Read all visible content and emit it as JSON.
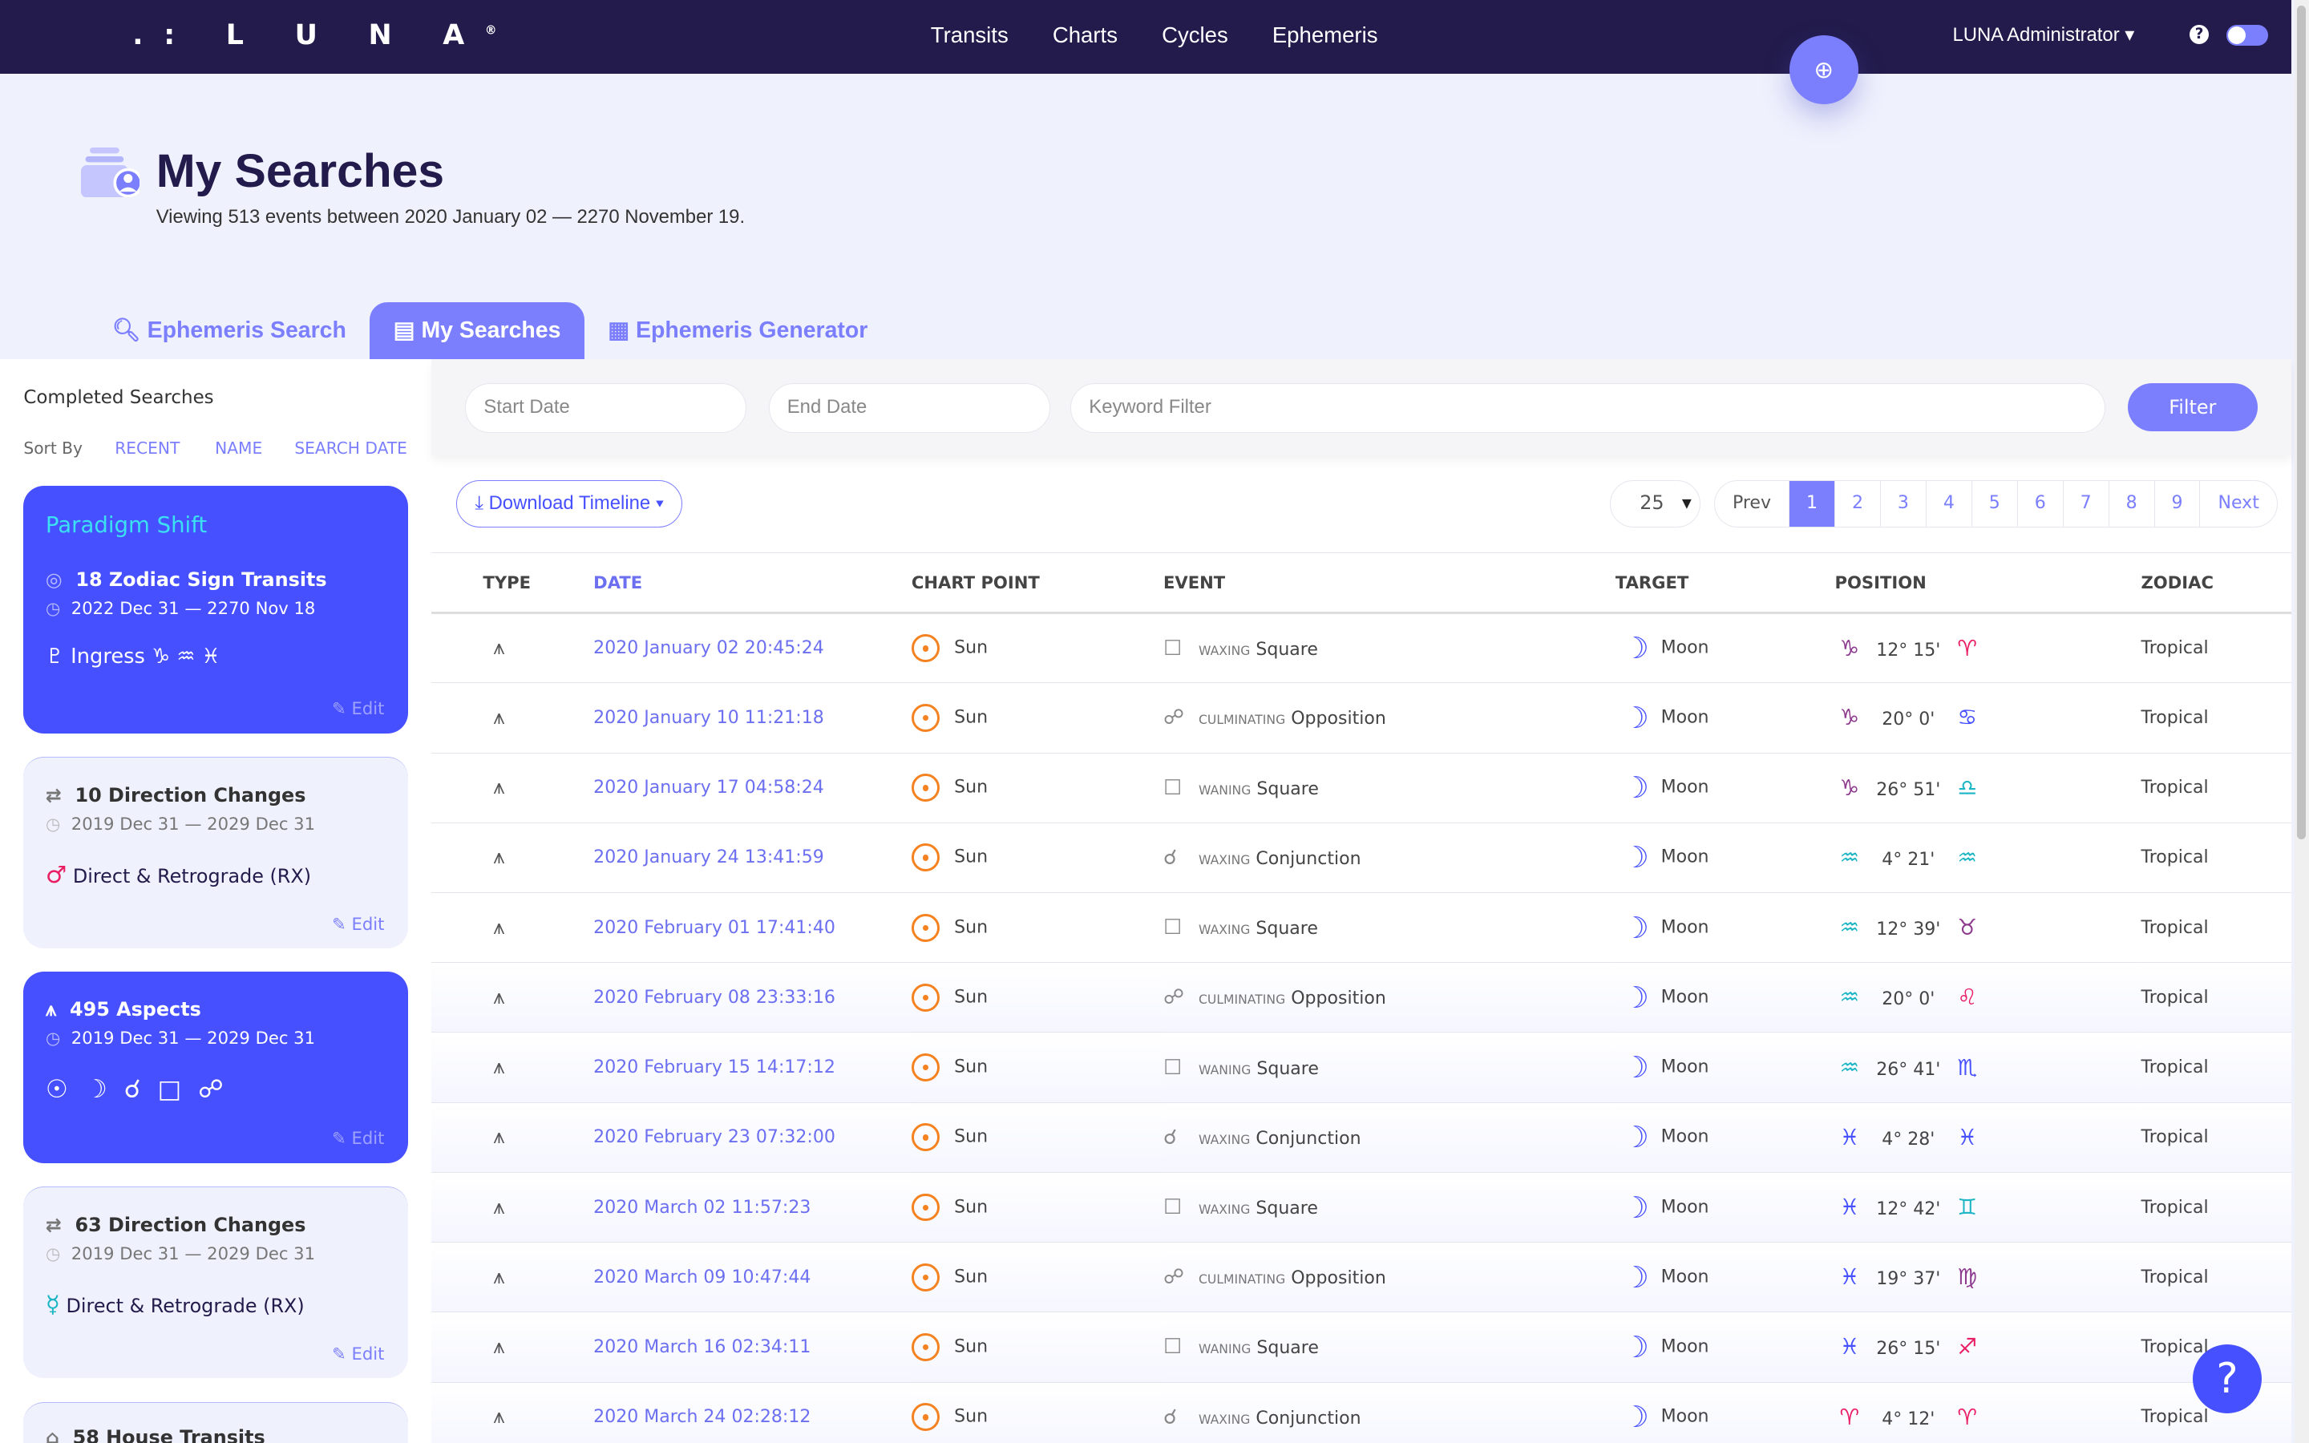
{
  "nav": {
    "logo": ".: L U N A",
    "links": [
      "Transits",
      "Charts",
      "Cycles",
      "Ephemeris"
    ],
    "user": "LUNA Administrator",
    "help": "?"
  },
  "header": {
    "title": "My Searches",
    "subtitle": "Viewing 513 events between 2020 January 02 — 2270 November 19."
  },
  "tabs": [
    "Ephemeris Search",
    "My Searches",
    "Ephemeris Generator"
  ],
  "sidebar": {
    "heading": "Completed Searches",
    "sort_label": "Sort By",
    "sort_options": [
      "RECENT",
      "NAME",
      "SEARCH DATE"
    ],
    "edit": "Edit",
    "cards": [
      {
        "name": "Paradigm Shift",
        "title": "18 Zodiac Sign Transits",
        "dates": "2022 Dec 31 — 2270 Nov 18",
        "line": "Ingress",
        "glyphs": "♑︎ ♒︎ ♓︎",
        "lead": "♇︎",
        "active": true
      },
      {
        "title": "10 Direction Changes",
        "dates": "2019 Dec 31 — 2029 Dec 31",
        "line": "Direct & Retrograde (RX)",
        "lead": "♂︎",
        "lead_color": "#e91e63",
        "active": false
      },
      {
        "title": "495 Aspects",
        "dates": "2019 Dec 31 — 2029 Dec 31",
        "glyphs": "☉︎ ☽︎ ☌︎ □ ☍︎",
        "active": true
      },
      {
        "title": "63 Direction Changes",
        "dates": "2019 Dec 31 — 2029 Dec 31",
        "line": "Direct & Retrograde (RX)",
        "lead": "☿︎",
        "lead_color": "#1bb5c4",
        "active": false
      },
      {
        "title": "58 House Transits",
        "active": false
      }
    ]
  },
  "filters": {
    "start_placeholder": "Start Date",
    "end_placeholder": "End Date",
    "keyword_placeholder": "Keyword Filter",
    "filter_button": "Filter"
  },
  "toolbar": {
    "download": "Download Timeline",
    "per_page": "25",
    "pagination": [
      "Prev",
      "1",
      "2",
      "3",
      "4",
      "5",
      "6",
      "7",
      "8",
      "9",
      "Next"
    ],
    "current_page": "1"
  },
  "table": {
    "columns": [
      "TYPE",
      "DATE",
      "CHART POINT",
      "EVENT",
      "TARGET",
      "POSITION",
      "ZODIAC"
    ],
    "rows": [
      {
        "date": "2020 January 02 20:45:24",
        "point": "Sun",
        "phase": "WAXING",
        "event": "Square",
        "target": "Moon",
        "s1": "♑︎",
        "c1": "#8e3a8e",
        "deg": "12° 15'",
        "s2": "♈︎",
        "c2": "#e91e63",
        "zodiac": "Tropical"
      },
      {
        "date": "2020 January 10 11:21:18",
        "point": "Sun",
        "phase": "CULMINATING",
        "event": "Opposition",
        "target": "Moon",
        "s1": "♑︎",
        "c1": "#8e3a8e",
        "deg": "20° 0'",
        "s2": "♋︎",
        "c2": "#4650ff",
        "zodiac": "Tropical"
      },
      {
        "date": "2020 January 17 04:58:24",
        "point": "Sun",
        "phase": "WANING",
        "event": "Square",
        "target": "Moon",
        "s1": "♑︎",
        "c1": "#8e3a8e",
        "deg": "26° 51'",
        "s2": "♎︎",
        "c2": "#1bb5c4",
        "zodiac": "Tropical"
      },
      {
        "date": "2020 January 24 13:41:59",
        "point": "Sun",
        "phase": "WAXING",
        "event": "Conjunction",
        "target": "Moon",
        "s1": "♒︎",
        "c1": "#1bb5c4",
        "deg": "4° 21'",
        "s2": "♒︎",
        "c2": "#1bb5c4",
        "zodiac": "Tropical"
      },
      {
        "date": "2020 February 01 17:41:40",
        "point": "Sun",
        "phase": "WAXING",
        "event": "Square",
        "target": "Moon",
        "s1": "♒︎",
        "c1": "#1bb5c4",
        "deg": "12° 39'",
        "s2": "♉︎",
        "c2": "#8e3a8e",
        "zodiac": "Tropical"
      },
      {
        "date": "2020 February 08 23:33:16",
        "point": "Sun",
        "phase": "CULMINATING",
        "event": "Opposition",
        "target": "Moon",
        "s1": "♒︎",
        "c1": "#1bb5c4",
        "deg": "20° 0'",
        "s2": "♌︎",
        "c2": "#e91e63",
        "zodiac": "Tropical"
      },
      {
        "date": "2020 February 15 14:17:12",
        "point": "Sun",
        "phase": "WANING",
        "event": "Square",
        "target": "Moon",
        "s1": "♒︎",
        "c1": "#1bb5c4",
        "deg": "26° 41'",
        "s2": "♏︎",
        "c2": "#4650ff",
        "zodiac": "Tropical"
      },
      {
        "date": "2020 February 23 07:32:00",
        "point": "Sun",
        "phase": "WAXING",
        "event": "Conjunction",
        "target": "Moon",
        "s1": "♓︎",
        "c1": "#4650ff",
        "deg": "4° 28'",
        "s2": "♓︎",
        "c2": "#4650ff",
        "zodiac": "Tropical"
      },
      {
        "date": "2020 March 02 11:57:23",
        "point": "Sun",
        "phase": "WAXING",
        "event": "Square",
        "target": "Moon",
        "s1": "♓︎",
        "c1": "#4650ff",
        "deg": "12° 42'",
        "s2": "♊︎",
        "c2": "#1bb5c4",
        "zodiac": "Tropical"
      },
      {
        "date": "2020 March 09 10:47:44",
        "point": "Sun",
        "phase": "CULMINATING",
        "event": "Opposition",
        "target": "Moon",
        "s1": "♓︎",
        "c1": "#4650ff",
        "deg": "19° 37'",
        "s2": "♍︎",
        "c2": "#8e3a8e",
        "zodiac": "Tropical"
      },
      {
        "date": "2020 March 16 02:34:11",
        "point": "Sun",
        "phase": "WANING",
        "event": "Square",
        "target": "Moon",
        "s1": "♓︎",
        "c1": "#4650ff",
        "deg": "26° 15'",
        "s2": "♐︎",
        "c2": "#e91e63",
        "zodiac": "Tropical"
      },
      {
        "date": "2020 March 24 02:28:12",
        "point": "Sun",
        "phase": "WAXING",
        "event": "Conjunction",
        "target": "Moon",
        "s1": "♈︎",
        "c1": "#e91e63",
        "deg": "4° 12'",
        "s2": "♈︎",
        "c2": "#e91e63",
        "zodiac": "Tropical"
      }
    ]
  },
  "help_button": "?"
}
